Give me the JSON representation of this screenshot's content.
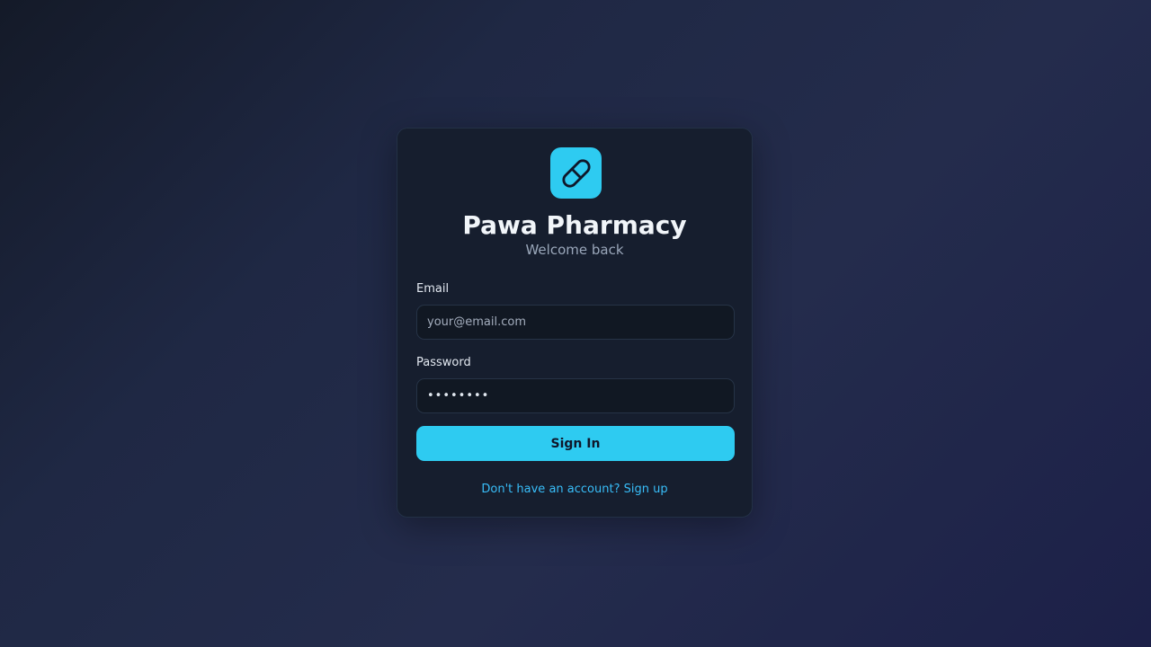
{
  "brand": {
    "name": "Pawa Pharmacy",
    "tagline": "Welcome back",
    "icon": "pill-icon",
    "accent_color": "#2ecbf1"
  },
  "form": {
    "email": {
      "label": "Email",
      "placeholder": "your@email.com",
      "value": ""
    },
    "password": {
      "label": "Password",
      "value": "••••••••"
    },
    "submit_label": "Sign In",
    "signup_link": "Don't have an account? Sign up"
  }
}
